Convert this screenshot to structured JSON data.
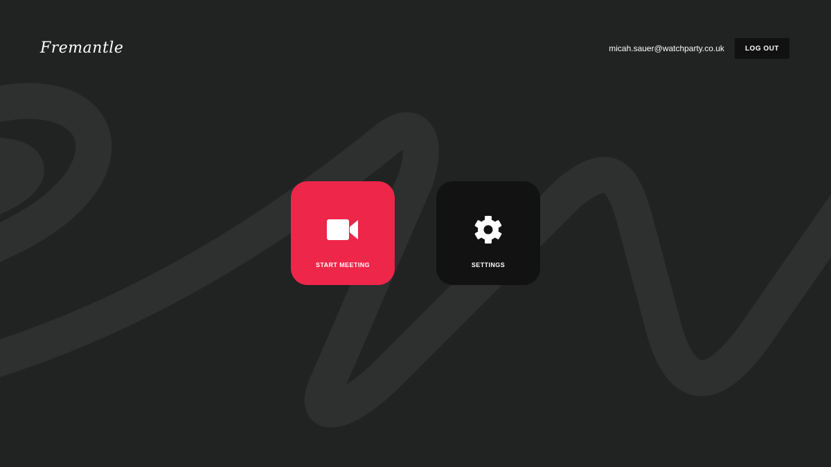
{
  "header": {
    "logo_text": "Fremantle",
    "user_email": "micah.sauer@watchparty.co.uk",
    "logout_label": "LOG OUT"
  },
  "tiles": {
    "start_meeting": {
      "label": "START MEETING",
      "icon": "video-camera-icon",
      "color": "#ee2649"
    },
    "settings": {
      "label": "SETTINGS",
      "icon": "gear-icon",
      "color": "#121212"
    }
  },
  "colors": {
    "background": "#212222",
    "swoosh": "#2e2f2f",
    "accent": "#ee2649"
  }
}
